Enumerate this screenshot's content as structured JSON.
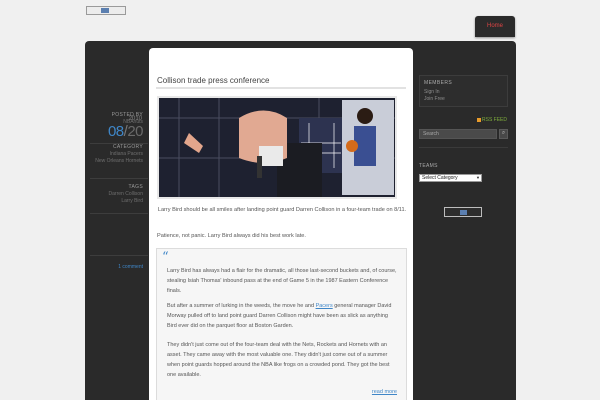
{
  "header": {
    "home_label": "Home"
  },
  "post": {
    "year": "2010",
    "month": "08",
    "day": "20",
    "posted_by_label": "POSTED BY",
    "author": "NBAnuts",
    "category_label": "CATEGORY",
    "categories": [
      "Indiana Pacers",
      "New Orleans Hornets"
    ],
    "tags_label": "TAGS",
    "tags": [
      "Darren Collison",
      "Larry Bird"
    ],
    "comments": "1 comment",
    "title": "Collison trade press conference",
    "caption": "Larry Bird should be all smiles after landing point guard Darren Collison in a four-team trade on 8/11.",
    "lead": "Patience, not panic. Larry Bird always did his best work late.",
    "quote": {
      "p1": "Larry Bird has always had a flair for the dramatic, all those last-second buckets and, of course, stealing Isiah Thomas' inbound pass at the end of Game 5 in the 1987 Eastern Conference finals.",
      "p2_before": "But after a summer of lurking in the weeds, the move he and ",
      "p2_link": "Pacers",
      "p2_after": " general manager David Morway pulled off to land point guard Darren Collison might have been as slick as anything Bird ever did on the parquet floor at Boston Garden.",
      "p3": "They didn't just come out of the four-team deal with the Nets, Rockets and Hornets with an asset. They came away with the most valuable one. They didn't just come out of a summer when point guards hopped around the NBA like frogs on a crowded pond. They got the best one available."
    },
    "read_more": "read more"
  },
  "sidebar": {
    "members_title": "MEMBERS",
    "sign_in": "Sign In",
    "join_free": "Join Free",
    "rss": "RSS FEED",
    "search_placeholder": "Search",
    "teams_title": "TEAMS",
    "select_value": "Select Category"
  },
  "colors": {
    "accent": "#3f86c7",
    "home": "#dd4444",
    "rss": "#7fae3c"
  }
}
